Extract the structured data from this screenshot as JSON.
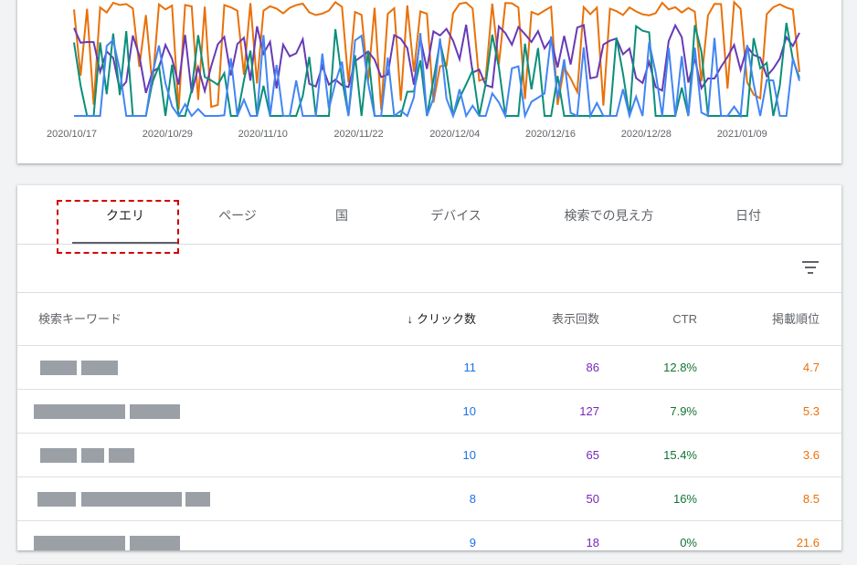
{
  "chart": {
    "x_labels": [
      "2020/10/17",
      "2020/10/29",
      "2020/11/10",
      "2020/11/22",
      "2020/12/04",
      "2020/12/16",
      "2020/12/28",
      "2021/01/09"
    ],
    "series_colors": {
      "clicks": "#4285f4",
      "impressions": "#673ab7",
      "ctr": "#0a8f7a",
      "position": "#e8710a"
    }
  },
  "tabs": [
    {
      "label": "クエリ",
      "active": true
    },
    {
      "label": "ページ",
      "active": false
    },
    {
      "label": "国",
      "active": false
    },
    {
      "label": "デバイス",
      "active": false
    },
    {
      "label": "検索での見え方",
      "active": false
    },
    {
      "label": "日付",
      "active": false
    }
  ],
  "table": {
    "headers": {
      "query": "検索キーワード",
      "clicks": "クリック数",
      "impressions": "表示回数",
      "ctr": "CTR",
      "position": "掲載順位"
    },
    "rows": [
      {
        "clicks": "11",
        "impressions": "86",
        "ctr": "12.8%",
        "position": "4.7"
      },
      {
        "clicks": "10",
        "impressions": "127",
        "ctr": "7.9%",
        "position": "5.3"
      },
      {
        "clicks": "10",
        "impressions": "65",
        "ctr": "15.4%",
        "position": "3.6"
      },
      {
        "clicks": "8",
        "impressions": "50",
        "ctr": "16%",
        "position": "8.5"
      },
      {
        "clicks": "9",
        "impressions": "18",
        "ctr": "0%",
        "position": "21.6"
      }
    ]
  },
  "icons": {
    "filter": "filter-list-icon",
    "sort": "arrow-down-icon"
  }
}
